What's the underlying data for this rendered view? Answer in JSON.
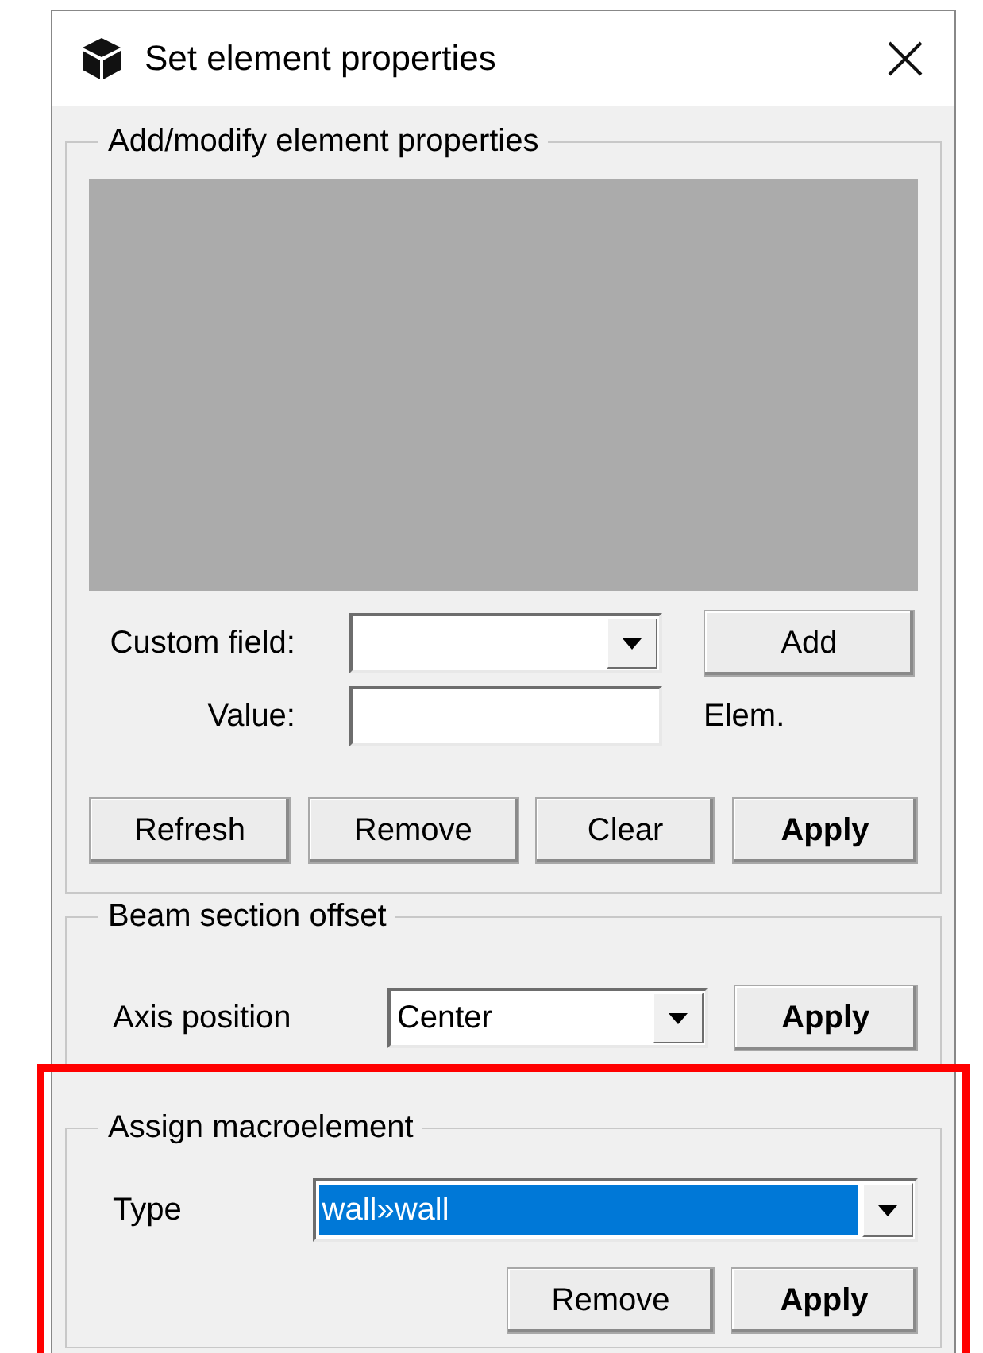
{
  "window": {
    "title": "Set element properties"
  },
  "sections": [
    {
      "kind": "properties",
      "title": "Add/modify element properties",
      "highlighted": false,
      "custom_field_label": "Custom field:",
      "add_button": "Add",
      "value_label": "Value:",
      "elem_label": "Elem.",
      "buttons": [
        {
          "label": "Refresh",
          "default": false
        },
        {
          "label": "Remove",
          "default": false
        },
        {
          "label": "Clear",
          "default": false
        },
        {
          "label": "Apply",
          "default": true
        }
      ]
    },
    {
      "kind": "offset",
      "title": "Beam section offset",
      "highlighted": false,
      "label": "Axis position",
      "value": "Center",
      "value_selected": false,
      "buttons": [
        {
          "label": "Apply",
          "default": true
        }
      ]
    },
    {
      "kind": "macro",
      "title": "Assign macroelement",
      "highlighted": true,
      "label": "Type",
      "value": "wall»wall",
      "value_selected": true,
      "buttons": [
        {
          "label": "Remove",
          "default": false
        },
        {
          "label": "Apply",
          "default": true
        }
      ]
    }
  ]
}
